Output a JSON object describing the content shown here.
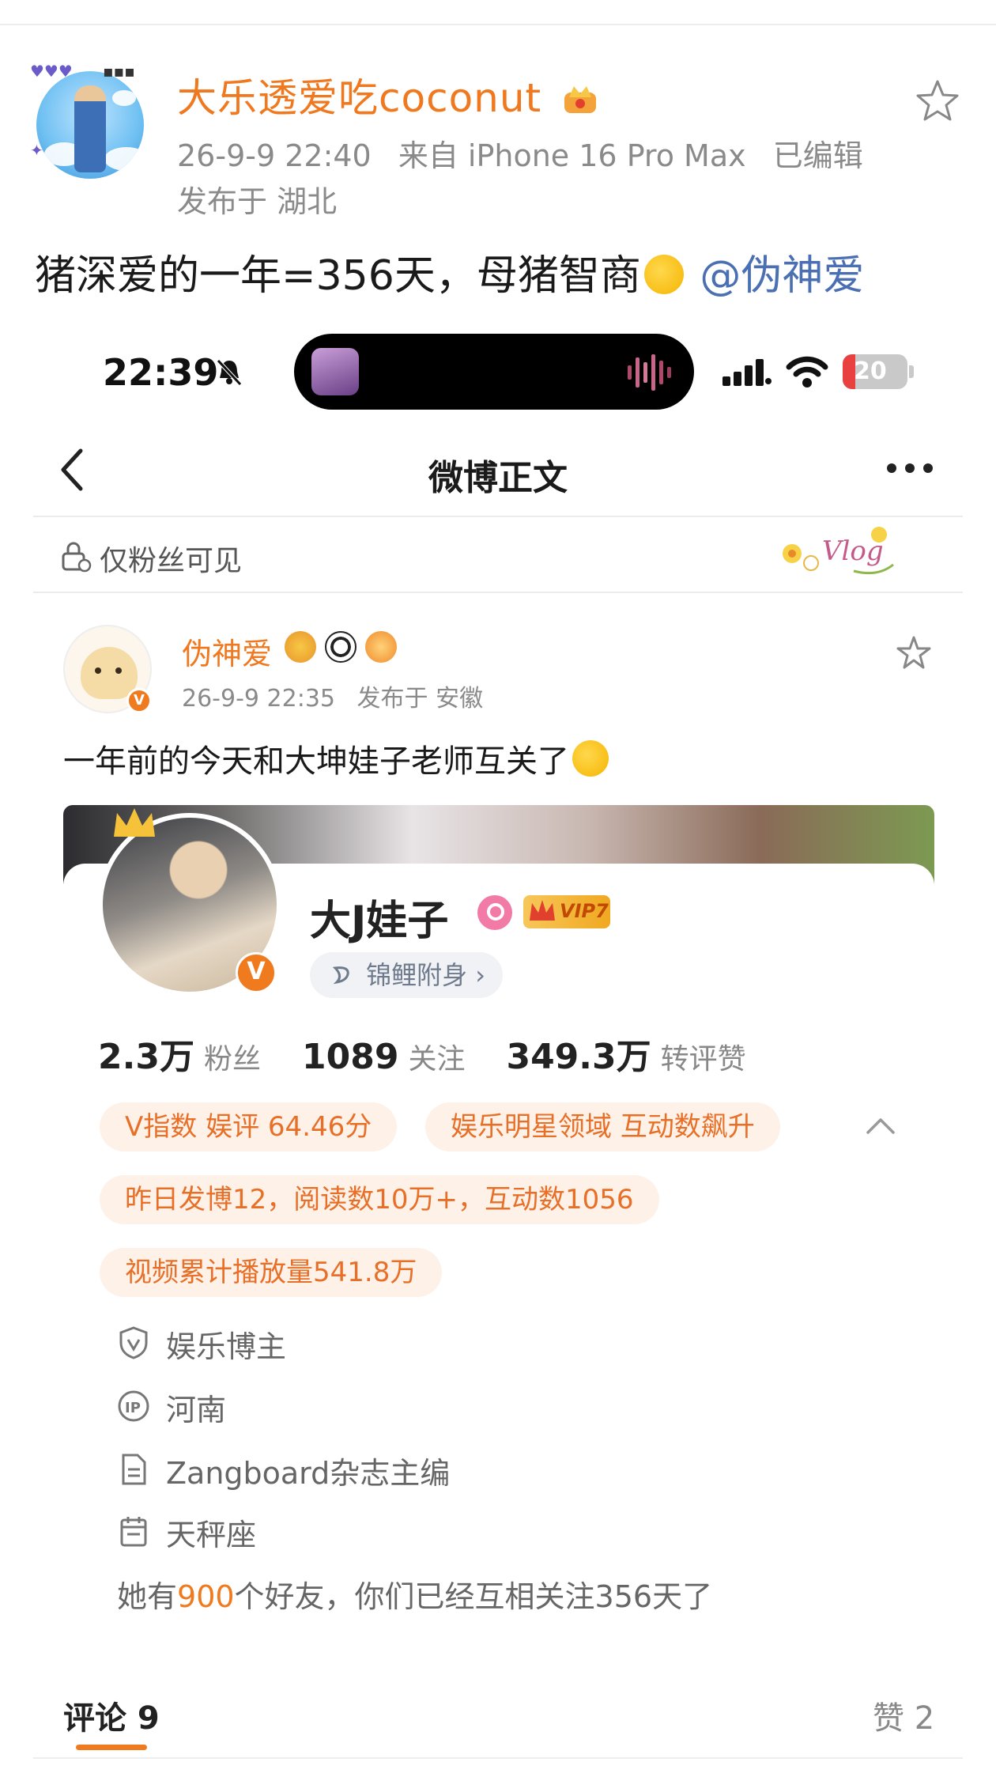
{
  "outer_post": {
    "author": "大乐透爱吃coconut",
    "time": "26-9-9 22:40",
    "source": "来自 iPhone 16 Pro Max",
    "edited": "已编辑",
    "location": "发布于 湖北",
    "text": "猪深爱的一年=356天，母猪智商",
    "mention": "@伪神爱"
  },
  "status_bar": {
    "time": "22:39",
    "battery": "20"
  },
  "nav": {
    "title": "微博正文"
  },
  "visibility": {
    "label": "仅粉丝可见"
  },
  "inner_post": {
    "author": "伪神爱",
    "time": "26-9-9 22:35",
    "location": "发布于 安徽",
    "text": "一年前的今天和大坤娃子老师互关了"
  },
  "profile_card": {
    "name": "大J娃子",
    "vip": "VIP7",
    "koi": "锦鲤附身 ›",
    "stats": [
      {
        "value": "2.3万",
        "label": "粉丝"
      },
      {
        "value": "1089",
        "label": "关注"
      },
      {
        "value": "349.3万",
        "label": "转评赞"
      }
    ],
    "chips": [
      "V指数 娱评 64.46分",
      "娱乐明星领域 互动数飙升",
      "昨日发博12，阅读数10万+，互动数1056",
      "视频累计播放量541.8万"
    ],
    "info": [
      {
        "icon": "shield-v-icon",
        "text": "娱乐博主"
      },
      {
        "icon": "ip-icon",
        "text": "河南"
      },
      {
        "icon": "document-icon",
        "text": "Zangboard杂志主编"
      },
      {
        "icon": "calendar-icon",
        "text": "天秤座"
      }
    ],
    "friends_prefix": "她有",
    "friends_count": "900",
    "friends_suffix": "个好友，你们已经互相关注356天了"
  },
  "tabs": {
    "comments": "评论 9",
    "likes": "赞 2"
  },
  "colors": {
    "accent": "#f0781e",
    "mention": "#4a6fb3",
    "chip_bg": "#fdf1e8"
  }
}
